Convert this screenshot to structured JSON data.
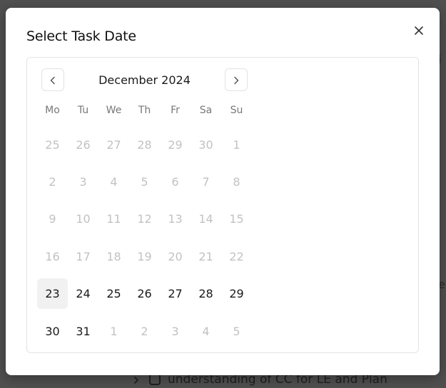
{
  "modal": {
    "title": "Select Task Date"
  },
  "calendar": {
    "month_label": "December 2024",
    "weekdays": [
      "Mo",
      "Tu",
      "We",
      "Th",
      "Fr",
      "Sa",
      "Su"
    ],
    "selected_day": 23,
    "weeks": [
      [
        {
          "d": "25",
          "m": "other"
        },
        {
          "d": "26",
          "m": "other"
        },
        {
          "d": "27",
          "m": "other"
        },
        {
          "d": "28",
          "m": "other"
        },
        {
          "d": "29",
          "m": "other"
        },
        {
          "d": "30",
          "m": "other"
        },
        {
          "d": "1",
          "m": "other"
        }
      ],
      [
        {
          "d": "2",
          "m": "other"
        },
        {
          "d": "3",
          "m": "other"
        },
        {
          "d": "4",
          "m": "other"
        },
        {
          "d": "5",
          "m": "other"
        },
        {
          "d": "6",
          "m": "other"
        },
        {
          "d": "7",
          "m": "other"
        },
        {
          "d": "8",
          "m": "other"
        }
      ],
      [
        {
          "d": "9",
          "m": "other"
        },
        {
          "d": "10",
          "m": "other"
        },
        {
          "d": "11",
          "m": "other"
        },
        {
          "d": "12",
          "m": "other"
        },
        {
          "d": "13",
          "m": "other"
        },
        {
          "d": "14",
          "m": "other"
        },
        {
          "d": "15",
          "m": "other"
        }
      ],
      [
        {
          "d": "16",
          "m": "other"
        },
        {
          "d": "17",
          "m": "other"
        },
        {
          "d": "18",
          "m": "other"
        },
        {
          "d": "19",
          "m": "other"
        },
        {
          "d": "20",
          "m": "other"
        },
        {
          "d": "21",
          "m": "other"
        },
        {
          "d": "22",
          "m": "other"
        }
      ],
      [
        {
          "d": "23",
          "m": "current"
        },
        {
          "d": "24",
          "m": "current"
        },
        {
          "d": "25",
          "m": "current"
        },
        {
          "d": "26",
          "m": "current"
        },
        {
          "d": "27",
          "m": "current"
        },
        {
          "d": "28",
          "m": "current"
        },
        {
          "d": "29",
          "m": "current"
        }
      ],
      [
        {
          "d": "30",
          "m": "current"
        },
        {
          "d": "31",
          "m": "current"
        },
        {
          "d": "1",
          "m": "other"
        },
        {
          "d": "2",
          "m": "other"
        },
        {
          "d": "3",
          "m": "other"
        },
        {
          "d": "4",
          "m": "other"
        },
        {
          "d": "5",
          "m": "other"
        }
      ]
    ]
  },
  "background": {
    "task_text": "understanding of CC for LE and Plan",
    "fragment_top": "i",
    "fragment_mid": "e"
  },
  "colors": {
    "overlay": "#505050",
    "muted_day": "#c2c2c2",
    "current_day": "#1a1a1a",
    "selected_bg": "#f1f1f1"
  }
}
